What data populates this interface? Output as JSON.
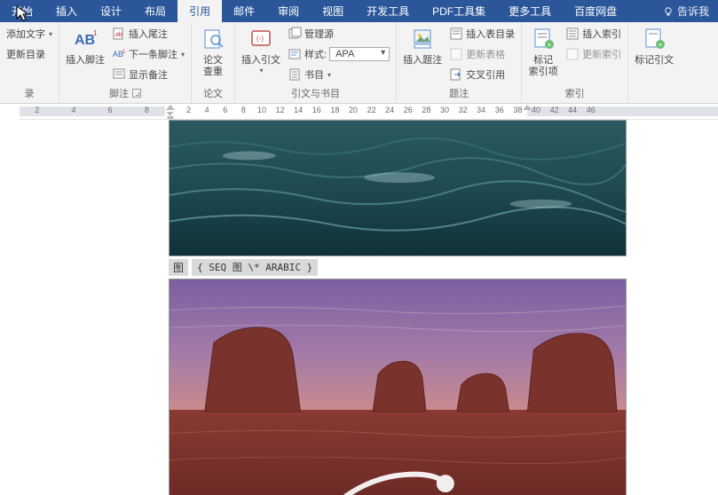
{
  "tabs": {
    "items": [
      "开始",
      "插入",
      "设计",
      "布局",
      "引用",
      "邮件",
      "审阅",
      "视图",
      "开发工具",
      "PDF工具集",
      "更多工具",
      "百度网盘"
    ],
    "active_index": 4,
    "tell_me": "告诉我"
  },
  "ribbon": {
    "toc": {
      "add_text": "添加文字",
      "update": "更新目录",
      "group": "录"
    },
    "footnotes": {
      "insert_footnote": "插入脚注",
      "insert_endnote": "插入尾注",
      "next_footnote": "下一条脚注",
      "show_notes": "显示备注",
      "group": "脚注"
    },
    "research": {
      "check": "论文\n查重",
      "group": "论文"
    },
    "citations": {
      "insert_citation": "插入引文",
      "manage_sources": "管理源",
      "style_label": "样式:",
      "style_value": "APA",
      "bibliography": "书目",
      "group": "引文与书目"
    },
    "captions": {
      "insert_caption": "插入题注",
      "insert_tof": "插入表目录",
      "update_table": "更新表格",
      "cross_ref": "交叉引用",
      "group": "题注"
    },
    "index": {
      "mark_entry": "标记\n索引项",
      "insert_index": "插入索引",
      "update_index": "更新索引",
      "group": "索引"
    },
    "toa": {
      "mark_citation": "标记引文"
    }
  },
  "ruler": {
    "left_ticks": [
      "8",
      "6",
      "4",
      "2"
    ],
    "right_ticks": [
      "2",
      "4",
      "6",
      "8",
      "10",
      "12",
      "14",
      "16",
      "18",
      "20",
      "22",
      "24",
      "26",
      "28",
      "30",
      "32",
      "34",
      "36",
      "38",
      "40",
      "42",
      "44",
      "46"
    ]
  },
  "document": {
    "caption_label": "图",
    "field_code": "{ SEQ 图 \\* ARABIC }"
  }
}
